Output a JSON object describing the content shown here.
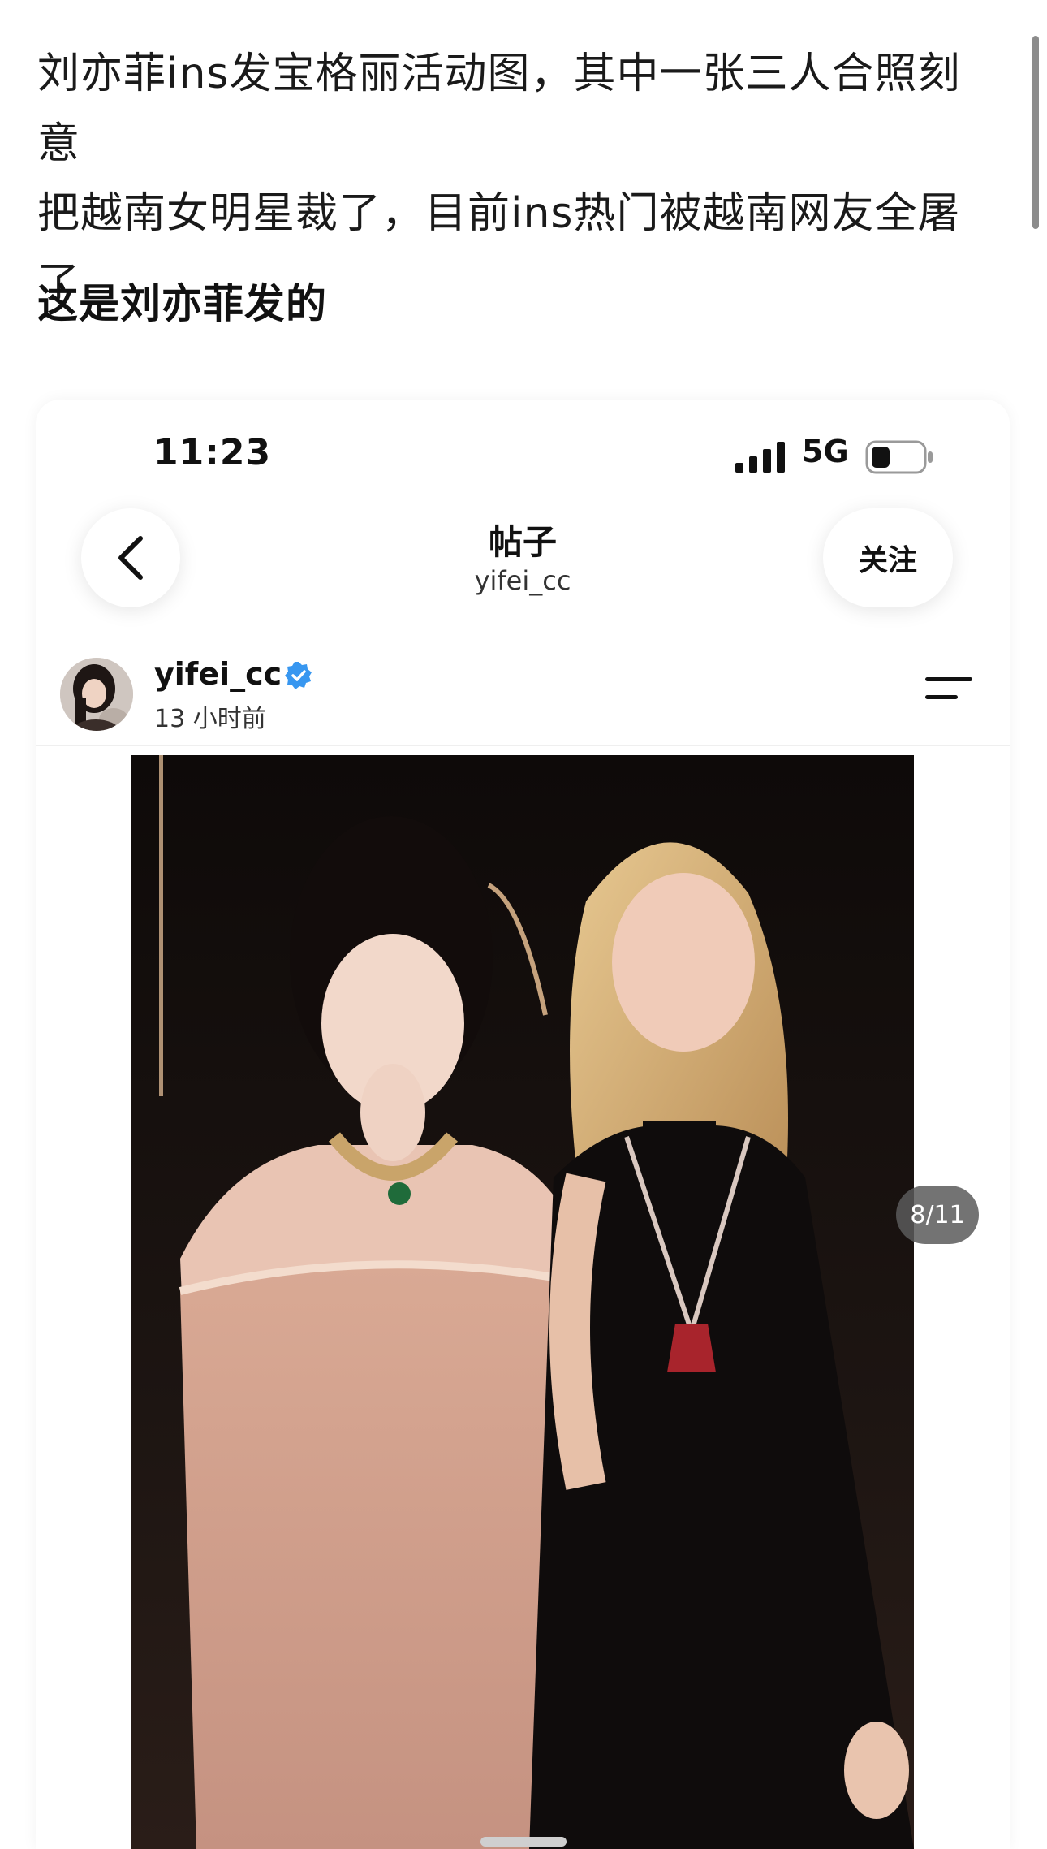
{
  "article": {
    "line1": "刘亦菲ins发宝格丽活动图，其中一张三人合照刻意",
    "line2": "把越南女明星裁了，目前ins热门被越南网友全屠了",
    "subheading": "这是刘亦菲发的"
  },
  "screenshot": {
    "status_bar": {
      "time": "11:23",
      "network": "5G",
      "signal_icon": "cellular-signal-icon",
      "battery_icon": "battery-icon"
    },
    "nav": {
      "back_icon": "chevron-left-icon",
      "title": "帖子",
      "subtitle": "yifei_cc",
      "follow_label": "关注"
    },
    "post": {
      "username": "yifei_cc",
      "verified_icon": "verified-badge-icon",
      "time": "13 小时前",
      "more_icon": "menu-icon",
      "page_counter": "8/11"
    }
  },
  "colors": {
    "verified_blue": "#3897f0",
    "counter_bg": "#5a5a5a",
    "text": "#111111"
  }
}
